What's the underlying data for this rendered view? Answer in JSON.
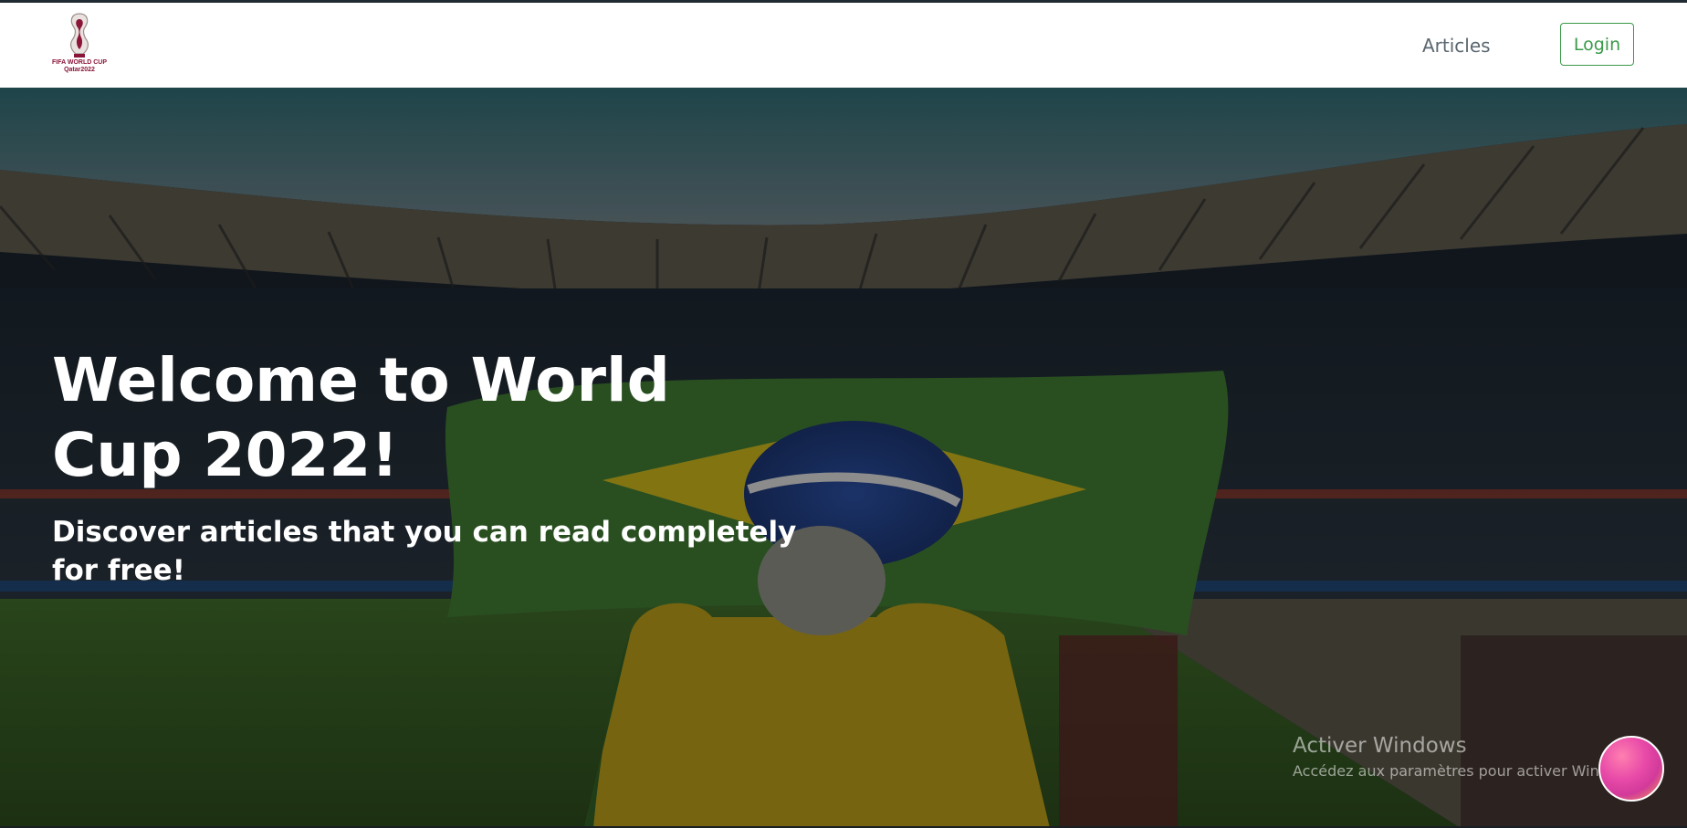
{
  "navbar": {
    "logo_caption_line1": "FIFA WORLD CUP",
    "logo_caption_line2": "Qatar2022",
    "articles_link": "Articles",
    "login_label": "Login"
  },
  "hero": {
    "title": "Welcome to World Cup 2022!",
    "subtitle": "Discover articles that you can read completely for free!"
  },
  "os_overlay": {
    "watermark_title": "Activer Windows",
    "watermark_subtitle": "Accédez aux paramètres pour activer Windows."
  },
  "colors": {
    "accent_green": "#3a9a48",
    "nav_text": "#5b6770",
    "brand_maroon": "#8a1538"
  },
  "icons": {
    "logo": "world-cup-trophy-logo",
    "bubble": "chat-bubble-icon"
  }
}
